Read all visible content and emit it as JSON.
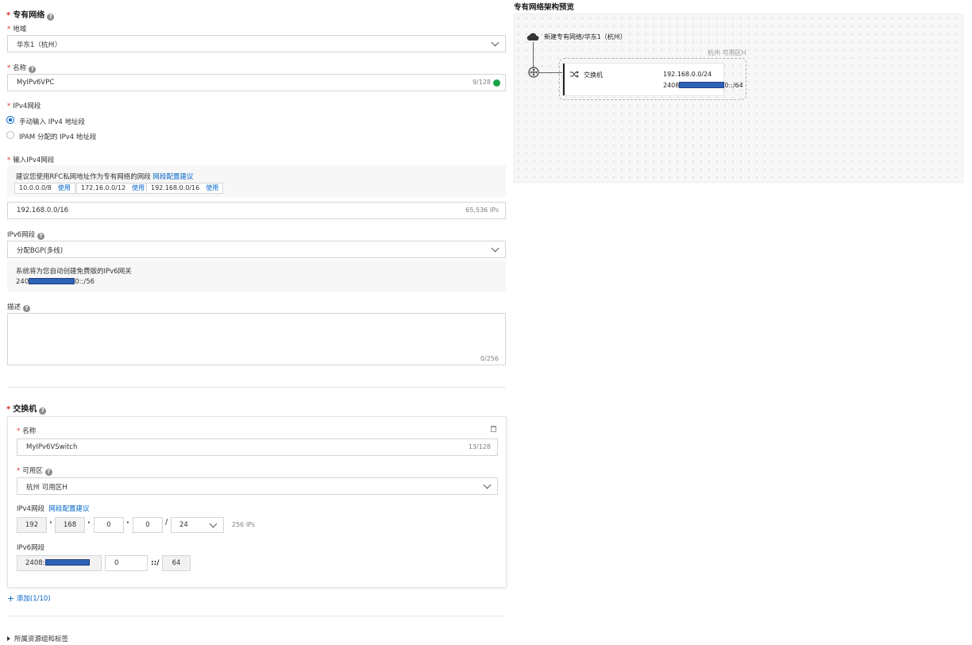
{
  "vpc": {
    "section_title": "专有网络",
    "region": {
      "label": "地域",
      "value": "华东1（杭州）"
    },
    "name": {
      "label": "名称",
      "value": "MyIPv6VPC",
      "counter": "9/128"
    },
    "ipv4_mode": {
      "label": "IPv4网段",
      "options": [
        "手动输入 IPv4 地址段",
        "IPAM 分配的 IPv4 地址段"
      ],
      "selected": 0
    },
    "ipv4_input": {
      "label": "输入IPv4网段",
      "hint": "建议您使用RFC私网地址作为专有网络的网段",
      "hint_link": "网段配置建议",
      "suggestions": [
        {
          "cidr": "10.0.0.0/8",
          "action": "使用"
        },
        {
          "cidr": "172.16.0.0/12",
          "action": "使用"
        },
        {
          "cidr": "192.168.0.0/16",
          "action": "使用"
        }
      ],
      "value": "192.168.0.0/16",
      "ip_count": "65,536 IPs"
    },
    "ipv6": {
      "label": "IPv6网段",
      "value": "分配BGP(多线)",
      "note": "系统将为您自动创建免费版的IPv6网关",
      "cidr_prefix": "240",
      "cidr_suffix": "0::/56"
    },
    "description": {
      "label": "描述",
      "counter": "0/256"
    }
  },
  "vswitch": {
    "section_title": "交换机",
    "name": {
      "label": "名称",
      "value": "MyIPv6VSwitch",
      "counter": "13/128"
    },
    "zone": {
      "label": "可用区",
      "value": "杭州 可用区H"
    },
    "ipv4": {
      "label": "IPv4网段",
      "link": "网段配置建议",
      "octets": [
        "192",
        "168",
        "0",
        "0"
      ],
      "mask": "24",
      "ip_count": "256 IPs"
    },
    "ipv6": {
      "label": "IPv6网段",
      "prefix": "2408:",
      "segment": "0",
      "separator": "::/",
      "mask": "64"
    }
  },
  "add_link": "添加(1/10)",
  "resource_group_toggle": "所属资源组和标签",
  "preview": {
    "title": "专有网络架构预览",
    "vpc_label": "新建专有网络/华东1（杭州）",
    "zone_label": "杭州 可用区H",
    "vswitch_label": "交换机",
    "ipv4_cidr": "192.168.0.0/24",
    "ipv6_prefix": "2408",
    "ipv6_suffix": "0::/64"
  },
  "colors": {
    "accent": "#0064c8",
    "required": "#d93026",
    "redaction": "#2f63b8",
    "ok": "#1aa34a"
  }
}
